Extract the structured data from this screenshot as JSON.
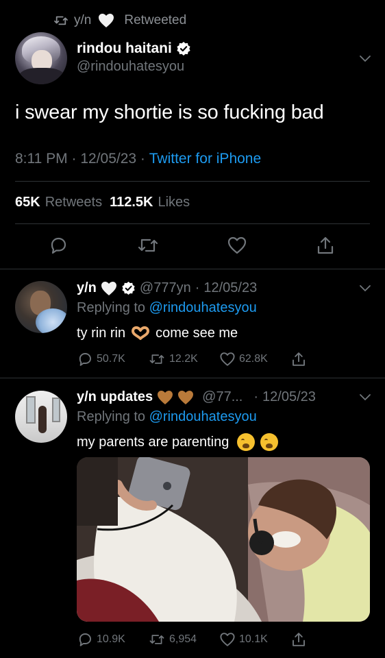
{
  "retweet_header": {
    "user": "y/n",
    "label": "Retweeted"
  },
  "main_tweet": {
    "display_name": "rindou haitani",
    "handle": "@rindouhatesyou",
    "text": "i swear my shortie is so fucking bad",
    "time": "8:11 PM",
    "date": "12/05/23",
    "source": "Twitter for iPhone",
    "retweets_count": "65K",
    "retweets_label": "Retweets",
    "likes_count": "112.5K",
    "likes_label": "Likes"
  },
  "replies": [
    {
      "display_name": "y/n",
      "handle": "@777yn",
      "date": "12/05/23",
      "replying_label": "Replying to",
      "replying_to": "@rindouhatesyou",
      "text_before": "ty rin rin",
      "text_after": "come see me",
      "replies": "50.7K",
      "retweets": "12.2K",
      "likes": "62.8K"
    },
    {
      "display_name": "y/n updates",
      "handle": "@77...",
      "date": "12/05/23",
      "replying_label": "Replying to",
      "replying_to": "@rindouhatesyou",
      "text": "my parents are parenting",
      "replies": "10.9K",
      "retweets": "6,954",
      "likes": "10.1K"
    }
  ],
  "colors": {
    "background": "#000000",
    "link": "#1d9bf0",
    "muted": "#71767b",
    "text": "#ffffff",
    "verified_badge": "#ffffff",
    "brown_heart": "#b97a3a"
  },
  "icons": [
    "retweet-icon",
    "white-heart-icon",
    "verified-icon",
    "chevron-down-icon",
    "reply-icon",
    "like-icon",
    "share-icon",
    "heart-hands-icon",
    "brown-heart-icon",
    "weary-face-icon"
  ]
}
